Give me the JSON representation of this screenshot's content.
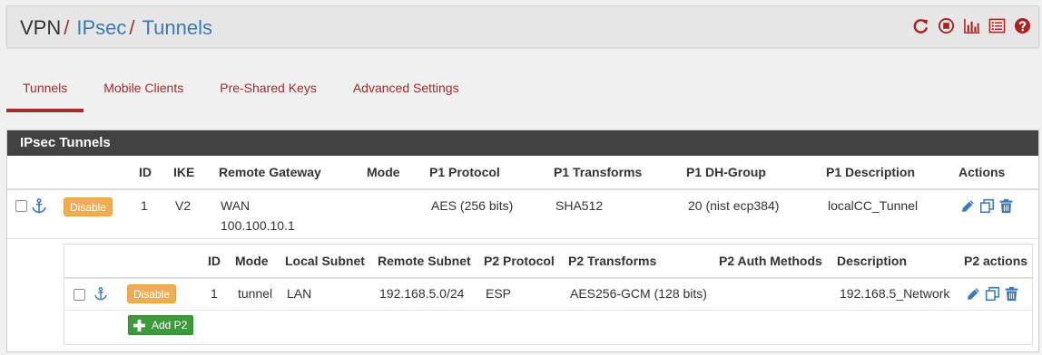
{
  "breadcrumb": {
    "vpn": "VPN",
    "sep": "/",
    "ipsec": "IPsec",
    "tunnels": "Tunnels"
  },
  "header_icons": [
    "restart-service-icon",
    "stop-service-icon",
    "status-graph-icon",
    "log-list-icon",
    "help-icon"
  ],
  "tabs": [
    {
      "label": "Tunnels",
      "active": true
    },
    {
      "label": "Mobile Clients",
      "active": false
    },
    {
      "label": "Pre-Shared Keys",
      "active": false
    },
    {
      "label": "Advanced Settings",
      "active": false
    }
  ],
  "panel": {
    "title": "IPsec Tunnels",
    "p1_headers": {
      "id": "ID",
      "ike": "IKE",
      "remote_gateway": "Remote Gateway",
      "mode": "Mode",
      "p1_protocol": "P1 Protocol",
      "p1_transforms": "P1 Transforms",
      "p1_dh_group": "P1 DH-Group",
      "p1_description": "P1 Description",
      "actions": "Actions"
    },
    "p1_row": {
      "disable_label": "Disable",
      "id": "1",
      "ike": "V2",
      "interface": "WAN",
      "remote_gateway": "100.100.10.1",
      "mode": "",
      "protocol": "AES (256 bits)",
      "transforms": "SHA512",
      "dh_group": "20 (nist ecp384)",
      "description": "localCC_Tunnel"
    },
    "p2_headers": {
      "id": "ID",
      "mode": "Mode",
      "local_subnet": "Local Subnet",
      "remote_subnet": "Remote Subnet",
      "p2_protocol": "P2 Protocol",
      "p2_transforms": "P2 Transforms",
      "p2_auth": "P2 Auth Methods",
      "description": "Description",
      "p2_actions": "P2 actions"
    },
    "p2_row": {
      "disable_label": "Disable",
      "id": "1",
      "mode": "tunnel",
      "local_subnet": "LAN",
      "remote_subnet": "192.168.5.0/24",
      "protocol": "ESP",
      "transforms": "AES256-GCM (128 bits)",
      "auth": "",
      "description": "192.168.5_Network"
    },
    "add_p2_label": "Add P2"
  },
  "colors": {
    "brand_red": "#a42b2b",
    "link_blue": "#3a79b8",
    "panel_dark": "#424242",
    "warning": "#f0ad4e",
    "success": "#3c9a3c"
  }
}
